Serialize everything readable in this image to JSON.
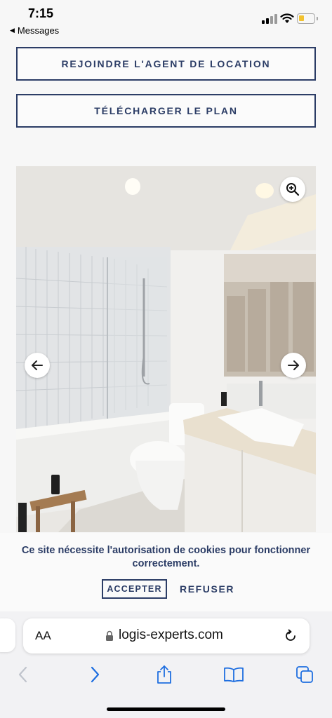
{
  "status_bar": {
    "time": "7:15",
    "back_label": "Messages",
    "icons": [
      "signal-icon",
      "wifi-icon",
      "battery-icon"
    ]
  },
  "actions": {
    "agent_button": "REJOINDRE L'AGENT DE LOCATION",
    "plan_button": "TÉLÉCHARGER LE PLAN"
  },
  "gallery": {
    "image": "bathroom-photo",
    "controls": [
      "zoom-in-icon",
      "arrow-left-icon",
      "arrow-right-icon"
    ]
  },
  "cookie_banner": {
    "message": "Ce site nécessite l'autorisation de cookies pour fonctionner correctement.",
    "accept_label": "ACCEPTER",
    "refuse_label": "REFUSER"
  },
  "browser": {
    "text_size_label": "AA",
    "url": "logis-experts.com",
    "toolbar_icons": [
      "back-icon",
      "forward-icon",
      "share-icon",
      "bookmarks-icon",
      "tabs-icon"
    ]
  },
  "colors": {
    "accent": "#2c3d66",
    "background": "#f7f7f7",
    "battery": "#f2c230"
  }
}
